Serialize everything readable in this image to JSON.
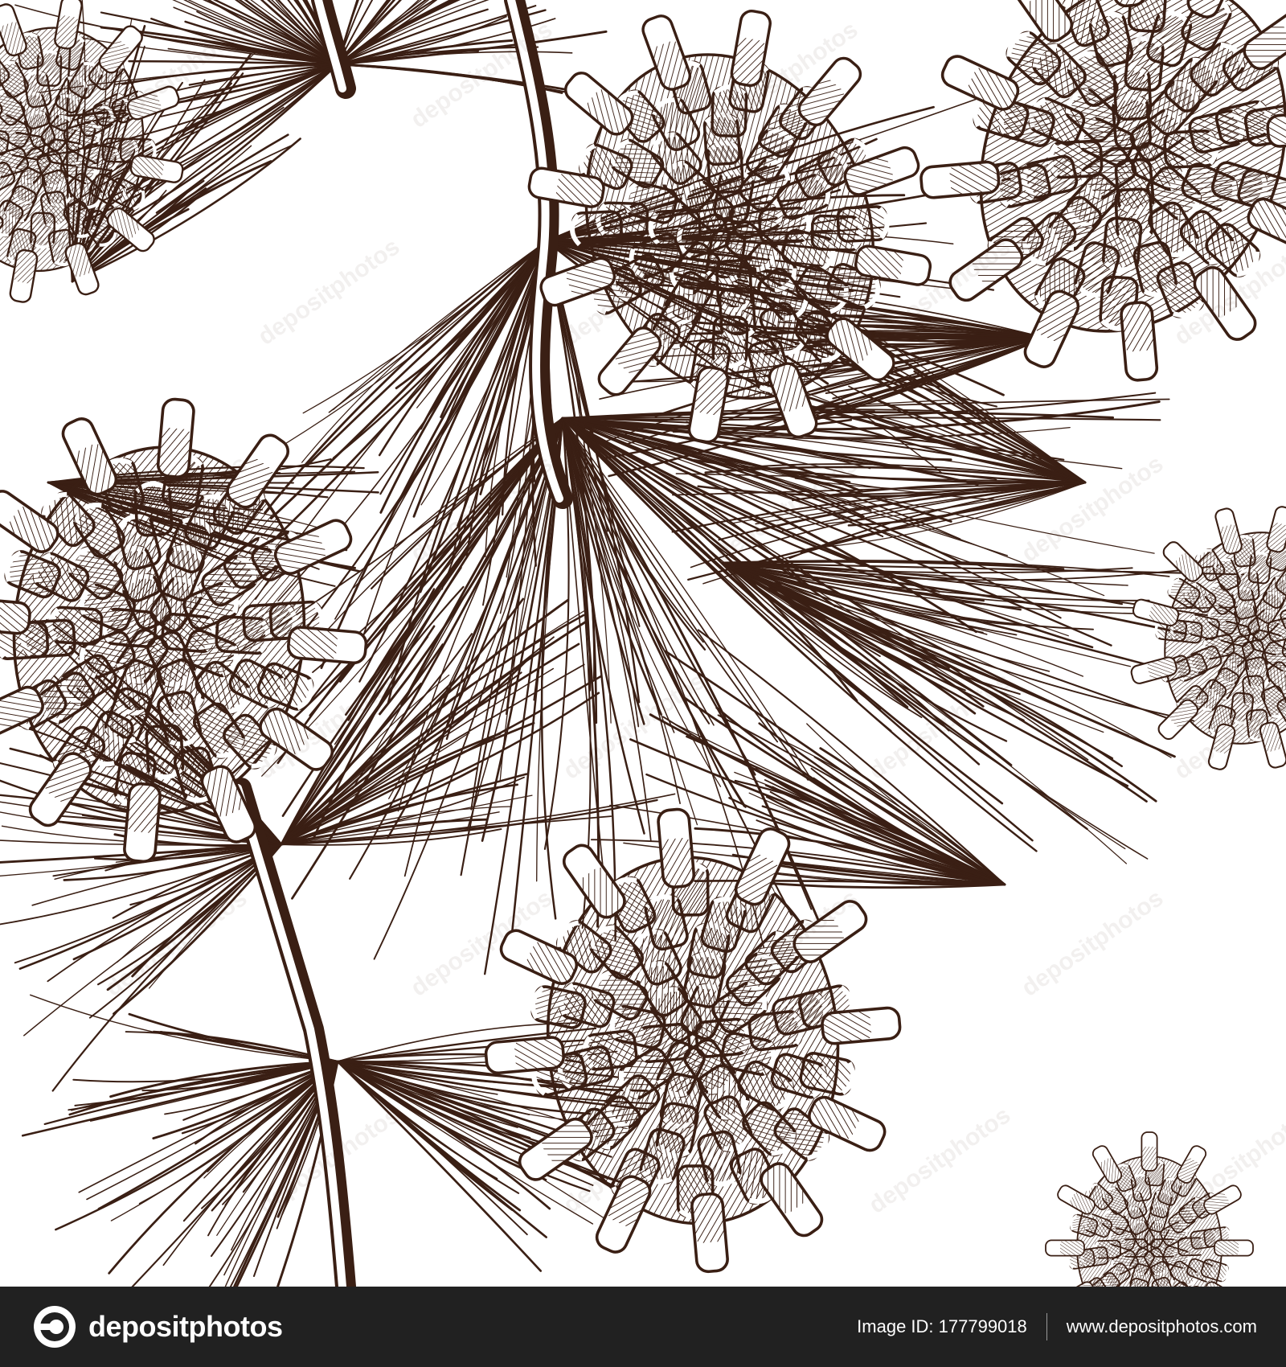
{
  "artwork": {
    "subject": "pine-branches-with-cones",
    "ink_color": "#3a1f14",
    "paper_color": "#ffffff",
    "watermark_text": "depositphotos"
  },
  "footer": {
    "brand": "depositphotos",
    "logo_icon": "depositphotos-logo-icon",
    "image_id": "Image ID: 177799018",
    "site_url": "www.depositphotos.com",
    "background": "#212121"
  }
}
